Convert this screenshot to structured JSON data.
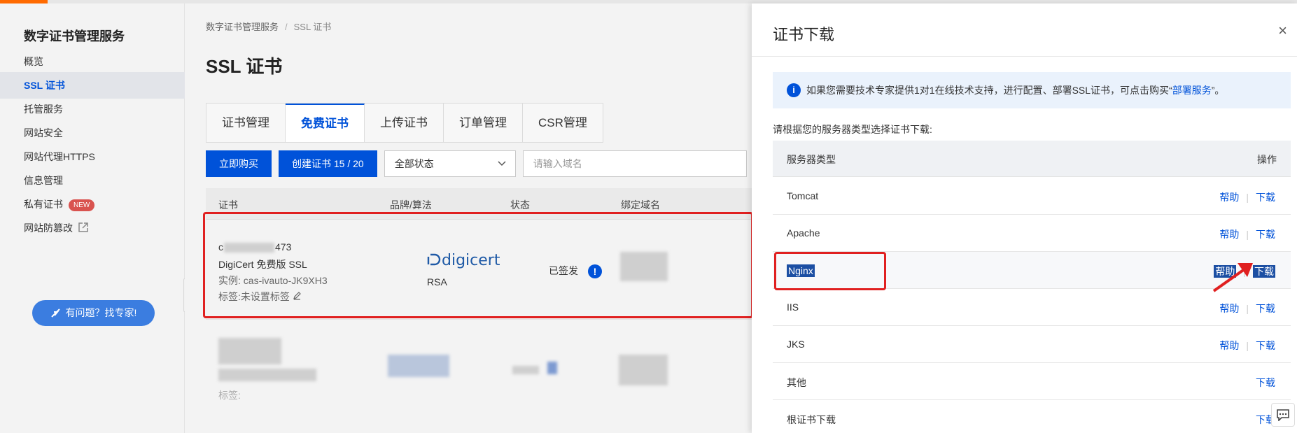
{
  "sidebar": {
    "title": "数字证书管理服务",
    "items": [
      {
        "label": "概览"
      },
      {
        "label": "SSL 证书"
      },
      {
        "label": "托管服务"
      },
      {
        "label": "网站安全"
      },
      {
        "label": "网站代理HTTPS"
      },
      {
        "label": "信息管理"
      },
      {
        "label": "私有证书",
        "badge": "NEW"
      },
      {
        "label": "网站防篡改",
        "icon": "external-link-icon"
      }
    ],
    "expert_button": "有问题？找专家!"
  },
  "breadcrumb": {
    "root": "数字证书管理服务",
    "separator": "/",
    "current": "SSL 证书"
  },
  "page_title": "SSL 证书",
  "tabs": [
    "证书管理",
    "免费证书",
    "上传证书",
    "订单管理",
    "CSR管理"
  ],
  "toolbar": {
    "buy_label": "立即购买",
    "create_label": "创建证书 15 / 20",
    "status_select": "全部状态",
    "search_placeholder": "请输入域名"
  },
  "table": {
    "columns": [
      "证书",
      "品牌/算法",
      "状态",
      "绑定域名"
    ],
    "row1": {
      "cert_id_prefix": "c",
      "cert_id_suffix": "473",
      "product": "DigiCert 免费版 SSL",
      "instance": "实例: cas-ivauto-JK9XH3",
      "tags": "标签:未设置标签",
      "brand": "digicert",
      "algorithm": "RSA",
      "status": "已签发",
      "status_icon": "!"
    },
    "row2": {
      "tags_prefix": "标签:"
    }
  },
  "drawer": {
    "title": "证书下载",
    "close": "×",
    "info_text": "如果您需要技术专家提供1对1在线技术支持，进行配置、部署SSL证书，可点击购买“",
    "info_link": "部署服务",
    "info_tail": "”。",
    "hint": "请根据您的服务器类型选择证书下载:",
    "header_server": "服务器类型",
    "header_action": "操作",
    "help_label": "帮助",
    "download_label": "下载",
    "rows": [
      {
        "name": "Tomcat"
      },
      {
        "name": "Apache"
      },
      {
        "name": "Nginx"
      },
      {
        "name": "IIS"
      },
      {
        "name": "JKS"
      },
      {
        "name": "其他"
      },
      {
        "name": "根证书下载"
      }
    ]
  },
  "colors": {
    "primary": "#0052d9",
    "highlight_red": "#e02020",
    "brand_orange": "#ff6a00"
  }
}
